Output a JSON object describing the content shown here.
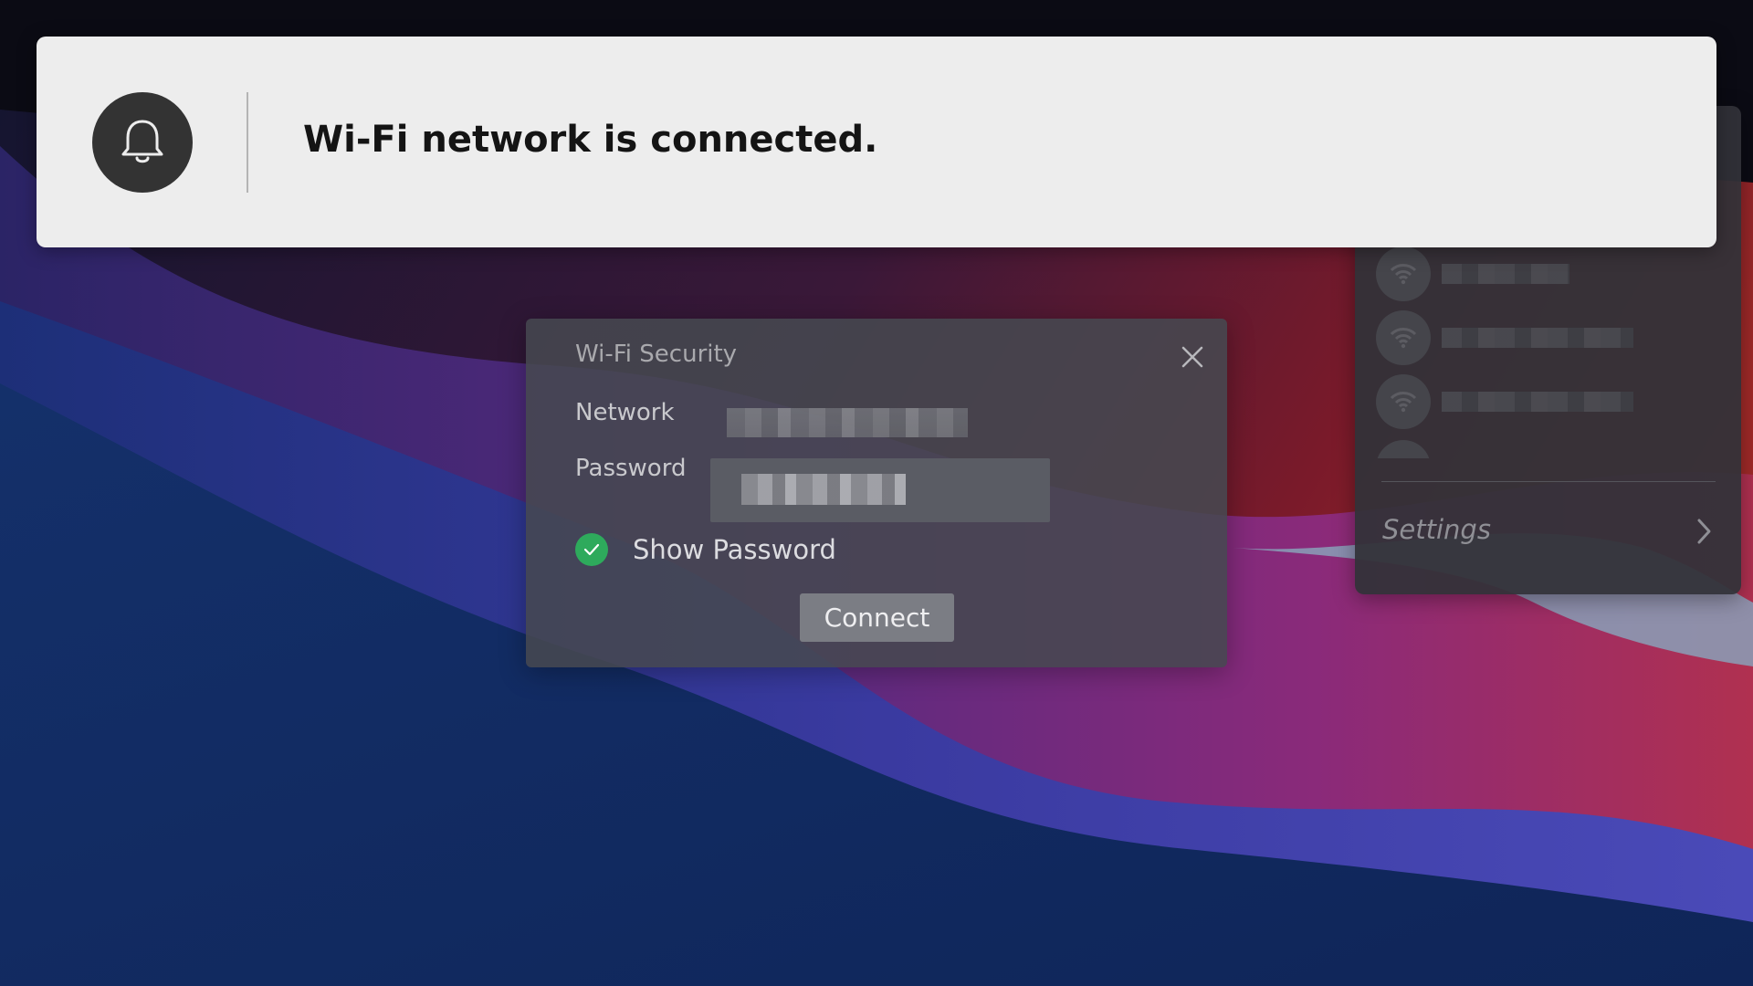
{
  "notification": {
    "message": "Wi-Fi network is connected.",
    "icon": "bell-icon"
  },
  "wifi_dialog": {
    "title": "Wi-Fi Security",
    "network_label": "Network",
    "password_label": "Password",
    "show_password_label": "Show Password",
    "show_password_checked": true,
    "connect_label": "Connect",
    "close_icon": "close-icon"
  },
  "wifi_panel": {
    "settings_label": "Settings",
    "settings_icon": "chevron-right-icon",
    "network_icon": "wifi-icon"
  },
  "colors": {
    "notification_bg": "#ededed",
    "check_green": "#2eaa5c",
    "dialog_bg": "#464850",
    "panel_bg": "#323238"
  }
}
